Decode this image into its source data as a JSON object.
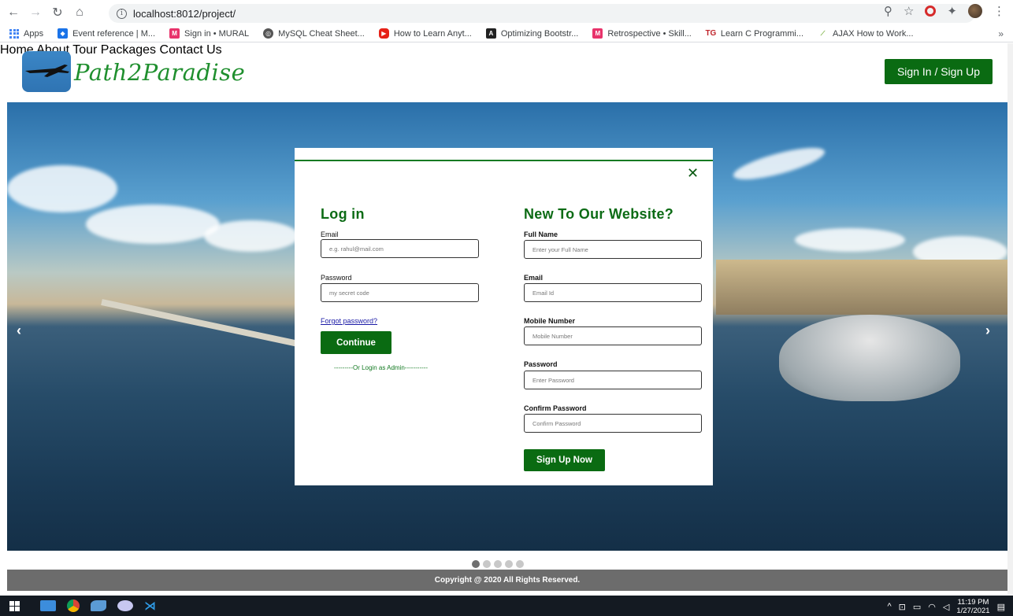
{
  "browser": {
    "url": "localhost:8012/project/",
    "bookmarks": [
      {
        "label": "Apps"
      },
      {
        "label": "Event reference | M..."
      },
      {
        "label": "Sign in • MURAL"
      },
      {
        "label": "MySQL Cheat Sheet..."
      },
      {
        "label": "How to Learn Anyt..."
      },
      {
        "label": "Optimizing Bootstr..."
      },
      {
        "label": "Retrospective • Skill..."
      },
      {
        "label": "Learn C Programmi..."
      },
      {
        "label": "AJAX How to Work..."
      }
    ],
    "more": "»"
  },
  "site": {
    "brand": "Path2Paradise",
    "nav": {
      "home": "Home",
      "about": "About",
      "tour_packages": "Tour Packages",
      "contact_us": "Contact Us"
    },
    "signin_button": "Sign In / Sign Up"
  },
  "hero": {
    "prev_arrow": "‹",
    "next_arrow": "›"
  },
  "modal": {
    "close": "✕",
    "login": {
      "title": "Log in",
      "email_label": "Email",
      "email_placeholder": "e.g. rahul@mail.com",
      "password_label": "Password",
      "password_placeholder": "my secret code",
      "forgot": "Forgot password?",
      "continue": "Continue",
      "admin_link": "---------Or Login as Admin-----------"
    },
    "signup": {
      "title": "New To Our Website?",
      "fullname_label": "Full Name",
      "fullname_placeholder": "Enter your Full Name",
      "email_label": "Email",
      "email_placeholder": "Email Id",
      "mobile_label": "Mobile Number",
      "mobile_placeholder": "Mobile Number",
      "password_label": "Password",
      "password_placeholder": "Enter Password",
      "confirm_label": "Confirm Password",
      "confirm_placeholder": "Confirm Password",
      "submit": "Sign Up Now"
    }
  },
  "footer": {
    "copyright": "Copyright @ 2020 All Rights Reserved."
  },
  "taskbar": {
    "time": "11:19 PM",
    "date": "1/27/2021"
  }
}
